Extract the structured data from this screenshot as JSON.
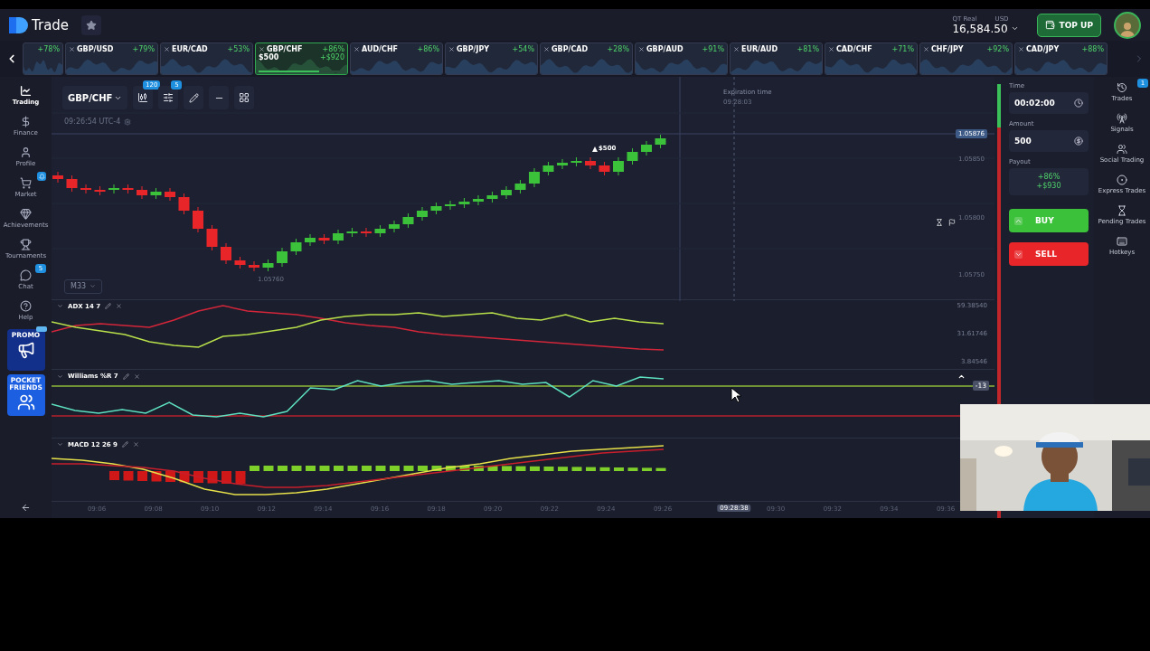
{
  "header": {
    "logo_text": "Trade",
    "account": {
      "type": "QT Real",
      "currency": "USD",
      "balance": "16,584.50"
    },
    "top_up": "TOP UP"
  },
  "assets": [
    {
      "percent": "+78%",
      "selected": false
    },
    {
      "name": "GBP/USD",
      "percent": "+79%",
      "selected": false
    },
    {
      "name": "EUR/CAD",
      "percent": "+53%",
      "selected": false
    },
    {
      "name": "GBP/CHF",
      "percent": "+86%",
      "selected": true,
      "stake": "$500",
      "profit": "+$920",
      "level": 0.7
    },
    {
      "name": "AUD/CHF",
      "percent": "+86%",
      "selected": false
    },
    {
      "name": "GBP/JPY",
      "percent": "+54%",
      "selected": false
    },
    {
      "name": "GBP/CAD",
      "percent": "+28%",
      "selected": false
    },
    {
      "name": "GBP/AUD",
      "percent": "+91%",
      "selected": false
    },
    {
      "name": "EUR/AUD",
      "percent": "+81%",
      "selected": false
    },
    {
      "name": "CAD/CHF",
      "percent": "+71%",
      "selected": false
    },
    {
      "name": "CHF/JPY",
      "percent": "+92%",
      "selected": false
    },
    {
      "name": "CAD/JPY",
      "percent": "+88%",
      "selected": false
    }
  ],
  "sidebar": {
    "items": [
      {
        "label": "Trading",
        "selected": true
      },
      {
        "label": "Finance",
        "selected": false
      },
      {
        "label": "Profile",
        "selected": false
      },
      {
        "label": "Market",
        "selected": false,
        "alert": true
      },
      {
        "label": "Achievements",
        "selected": false
      },
      {
        "label": "Tournaments",
        "selected": false
      },
      {
        "label": "Chat",
        "selected": false,
        "badge": "5"
      },
      {
        "label": "Help",
        "selected": false
      }
    ],
    "promos": [
      {
        "label": "PROMO",
        "new": true
      },
      {
        "label": "POCKET FRIENDS",
        "new": false
      }
    ]
  },
  "chart": {
    "pair": "GBP/CHF",
    "toolbar_badges": [
      "120",
      "5"
    ],
    "clock": "09:26:54 UTC-4",
    "timeframe": "M33",
    "price_labels": [
      {
        "text": "1.05876",
        "current": true
      },
      {
        "text": "1.05850",
        "current": false
      },
      {
        "text": "1.05800",
        "current": false
      },
      {
        "text": "1.05750",
        "current": false
      }
    ],
    "low_label": "1.05760",
    "trade_marker": "$500",
    "expiration": {
      "label": "Expiration time",
      "time": "09:28:03"
    },
    "indicators": [
      {
        "kind": "adx",
        "name": "ADX 14 7",
        "values": [
          "59.38540",
          "31.61746",
          "3.84546"
        ]
      },
      {
        "kind": "williams",
        "name": "Williams %R 7",
        "marker": "-13"
      },
      {
        "kind": "macd",
        "name": "MACD 12 26 9"
      }
    ],
    "time_axis": {
      "ticks": [
        "09:06",
        "09:08",
        "09:10",
        "09:12",
        "09:14",
        "09:16",
        "09:18",
        "09:20",
        "09:22",
        "09:24",
        "09:26",
        "09:30",
        "09:32",
        "09:34",
        "09:36"
      ],
      "cursor": "09:28:38"
    }
  },
  "sentiment": {
    "level": 0.1
  },
  "trade_panel": {
    "time_label": "Time",
    "time": "00:02:00",
    "amount_label": "Amount",
    "amount": "500",
    "payout_label": "Payout",
    "payout_percent": "+86%",
    "payout_value": "+$930",
    "buy": "BUY",
    "sell": "SELL"
  },
  "right_sidebar": [
    {
      "label": "Trades",
      "badge": "1"
    },
    {
      "label": "Signals"
    },
    {
      "label": "Social Trading"
    },
    {
      "label": "Express Trades"
    },
    {
      "label": "Pending Trades"
    },
    {
      "label": "Hotkeys"
    }
  ]
}
